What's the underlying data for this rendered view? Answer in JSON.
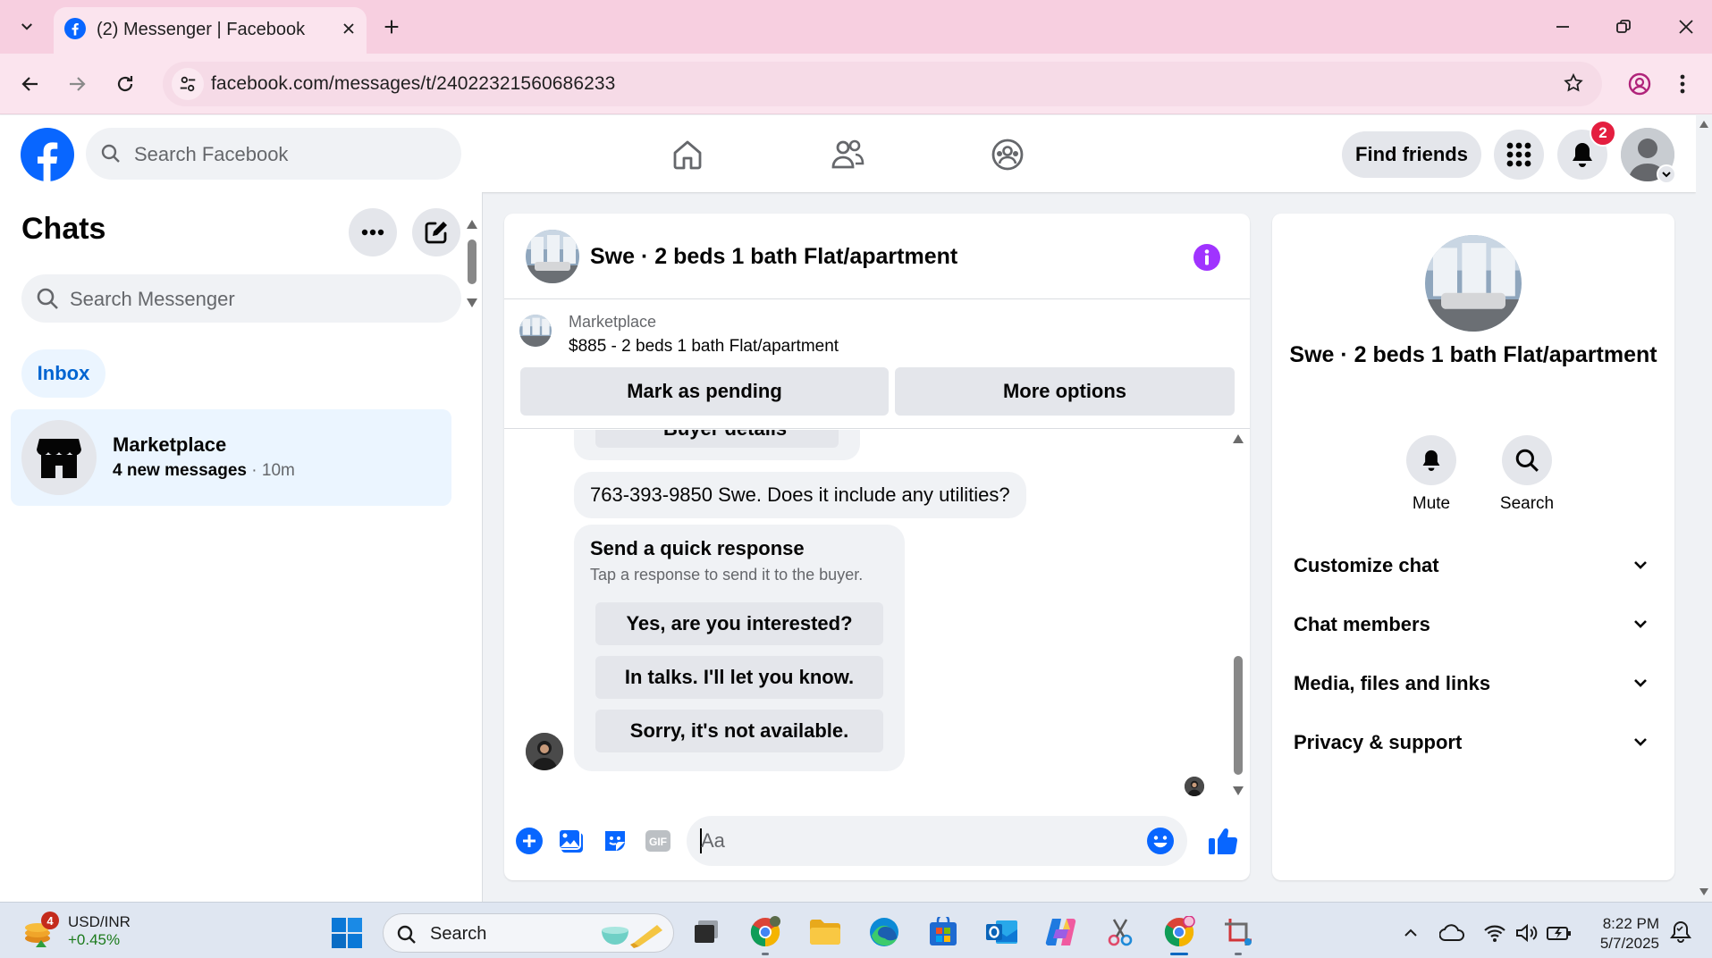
{
  "browser": {
    "tab_title": "(2) Messenger | Facebook",
    "url": "facebook.com/messages/t/24022321560686233"
  },
  "fb_header": {
    "search_placeholder": "Search Facebook",
    "find_friends": "Find friends",
    "notification_count": "2"
  },
  "chats": {
    "title": "Chats",
    "search_placeholder": "Search Messenger",
    "filter_tab": "Inbox",
    "conversations": [
      {
        "name": "Marketplace",
        "preview": "4 new messages",
        "separator": " · ",
        "time": "10m"
      }
    ]
  },
  "conversation": {
    "title": "Swe · 2 beds 1 bath Flat/apartment",
    "listing": {
      "label": "Marketplace",
      "price_title": "$885 - 2 beds 1 bath Flat/apartment",
      "mark_pending": "Mark as pending",
      "more_options": "More options"
    },
    "messages": {
      "clipped_button": "Buyer details",
      "phone_message": "763-393-9850 Swe. Does it include any utilities?",
      "quick_response": {
        "heading": "Send a quick response",
        "subheading": "Tap a response to send it to the buyer.",
        "options": [
          "Yes, are you interested?",
          "In talks. I'll let you know.",
          "Sorry, it's not available."
        ]
      }
    },
    "composer_placeholder": "Aa"
  },
  "info_panel": {
    "title": "Swe · 2 beds 1 bath Flat/apartment",
    "actions": [
      {
        "label": "Mute",
        "icon": "bell-icon"
      },
      {
        "label": "Search",
        "icon": "search-icon"
      }
    ],
    "sections": [
      "Customize chat",
      "Chat members",
      "Media, files and links",
      "Privacy & support"
    ]
  },
  "taskbar": {
    "widget_badge": "4",
    "ticker_name": "USD/INR",
    "ticker_change": "+0.45%",
    "search_placeholder": "Search",
    "time": "8:22 PM",
    "date": "5/7/2025"
  },
  "colors": {
    "fb_blue": "#0866ff",
    "messenger_purple": "#a033ff",
    "chrome_pink": "#f7cfe0",
    "badge_red": "#e41e3f",
    "selected_bg": "#ebf5ff"
  }
}
